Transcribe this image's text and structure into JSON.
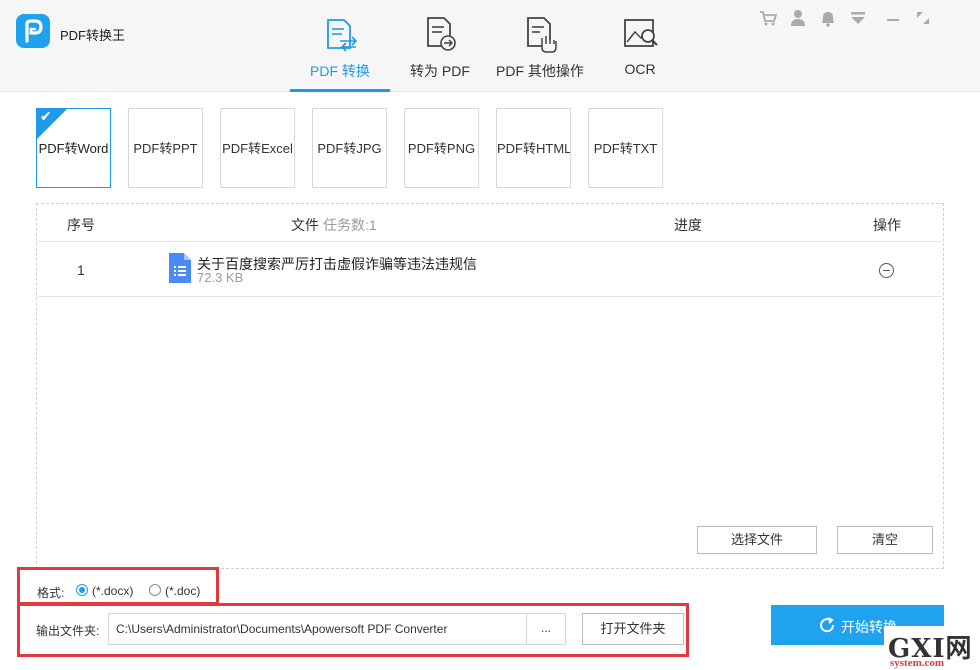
{
  "app": {
    "title": "PDF转换王"
  },
  "nav": {
    "tabs": [
      {
        "label": "PDF 转换",
        "icon": "pdf-convert-icon",
        "active": true
      },
      {
        "label": "转为 PDF",
        "icon": "to-pdf-icon"
      },
      {
        "label": "PDF 其他操作",
        "icon": "pdf-tools-icon"
      },
      {
        "label": "OCR",
        "icon": "ocr-icon"
      }
    ]
  },
  "window_controls": [
    "cart-icon",
    "user-icon",
    "bell-icon",
    "menu-dropdown-icon",
    "minimize-icon",
    "restore-icon"
  ],
  "types": [
    {
      "label": "PDF转Word",
      "selected": true
    },
    {
      "label": "PDF转PPT"
    },
    {
      "label": "PDF转Excel"
    },
    {
      "label": "PDF转JPG"
    },
    {
      "label": "PDF转PNG"
    },
    {
      "label": "PDF转HTML"
    },
    {
      "label": "PDF转TXT"
    }
  ],
  "list": {
    "headers": {
      "index": "序号",
      "file": "文件",
      "task_count": "任务数:1",
      "progress": "进度",
      "action": "操作"
    },
    "rows": [
      {
        "index": "1",
        "name": "关于百度搜索严厉打击虚假诈骗等违法违规信",
        "size": "72.3 KB"
      }
    ],
    "select_button": "选择文件",
    "clear_button": "清空"
  },
  "format": {
    "label": "格式:",
    "options": [
      {
        "label": "(*.docx)",
        "selected": true
      },
      {
        "label": "(*.doc)",
        "selected": false
      }
    ]
  },
  "output": {
    "label": "输出文件夹:",
    "path": "C:\\Users\\Administrator\\Documents\\Apowersoft PDF Converter",
    "browse": "...",
    "open_button": "打开文件夹"
  },
  "start_button": "开始转换",
  "watermark": {
    "text": "GXI网",
    "sub": "system.com"
  },
  "colors": {
    "accent": "#1e9be8",
    "highlight": "#e03a3e"
  }
}
